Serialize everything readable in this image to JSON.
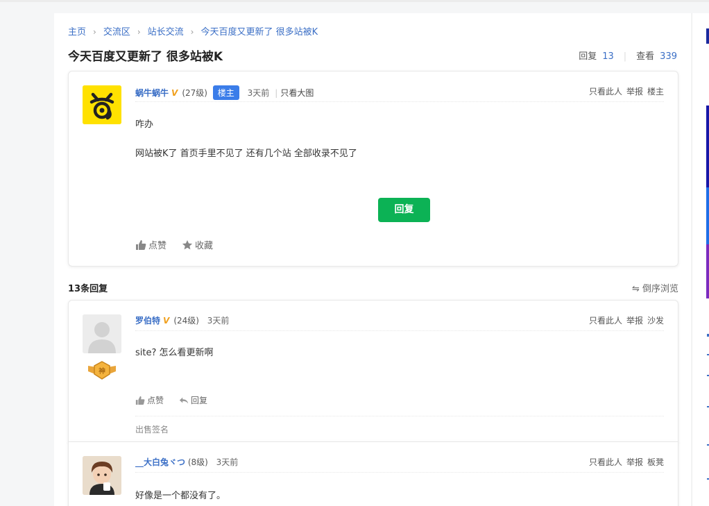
{
  "breadcrumb": [
    "主页",
    "交流区",
    "站长交流",
    "今天百度又更新了 很多站被K"
  ],
  "thread": {
    "title": "今天百度又更新了 很多站被K",
    "reply_label": "回复",
    "reply_count": "13",
    "view_label": "查看",
    "view_count": "339"
  },
  "op_post": {
    "username": "蜗牛蜗牛",
    "vip": "V",
    "level": "(27级)",
    "badge": "楼主",
    "time": "3天前",
    "view_big": "只看大图",
    "actions": [
      "只看此人",
      "举报",
      "楼主"
    ],
    "lines": [
      "咋办",
      "网站被K了  首页手里不见了  还有几个站 全部收录不见了"
    ],
    "reply_button": "回复",
    "like": "点赞",
    "favorite": "收藏"
  },
  "replies_header": {
    "count": "13条回复",
    "order": "倒序浏览"
  },
  "replies": [
    {
      "username": "罗伯特",
      "vip": "V",
      "level": "(24级)",
      "time": "3天前",
      "actions": [
        "只看此人",
        "举报",
        "沙发"
      ],
      "medal": "神",
      "content": "site?  怎么看更新啊",
      "like": "点赞",
      "reply": "回复",
      "signature": "出售签名"
    },
    {
      "username": "__大白兔ヾつ",
      "level": "(8级)",
      "time": "3天前",
      "actions": [
        "只看此人",
        "举报",
        "板凳"
      ],
      "content": "好像是一个都没有了。"
    }
  ],
  "colors": {
    "link": "#3b6fc6",
    "reply_button": "#0cb255",
    "op_badge": "#3b7de9",
    "vip": "#f0a01e",
    "op_avatar_bg": "#ffe100"
  }
}
